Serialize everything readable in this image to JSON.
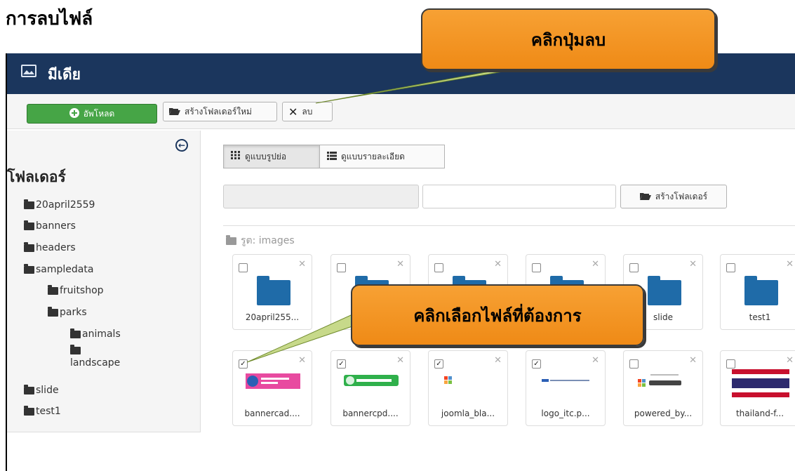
{
  "doc_title": "การลบไฟล์",
  "header": {
    "title": "มีเดีย"
  },
  "toolbar": {
    "upload_label": "อัพโหลด",
    "new_folder_label": "สร้างโฟลเดอร์ใหม่",
    "delete_label": "ลบ"
  },
  "sidebar": {
    "title": "โฟลเดอร์",
    "folders": [
      {
        "label": "20april2559"
      },
      {
        "label": "banners"
      },
      {
        "label": "headers"
      },
      {
        "label": "sampledata"
      },
      {
        "label": "fruitshop"
      },
      {
        "label": "parks"
      },
      {
        "label": "animals"
      },
      {
        "label": "landscape"
      },
      {
        "label": "slide"
      },
      {
        "label": "test1"
      }
    ]
  },
  "view": {
    "thumbnails_label": "ดูแบบรูปย่อ",
    "details_label": "ดูแบบรายละเอียด"
  },
  "folder_form": {
    "path_value": "",
    "folder_name_value": "",
    "create_label": "สร้างโฟลเดอร์"
  },
  "breadcrumb": {
    "root_label": "รูต: images"
  },
  "items": [
    {
      "name": "20april255...",
      "type": "folder",
      "checked": false
    },
    {
      "name": "",
      "type": "folder",
      "checked": false
    },
    {
      "name": "",
      "type": "folder",
      "checked": false
    },
    {
      "name": "",
      "type": "folder",
      "checked": false
    },
    {
      "name": "slide",
      "type": "folder",
      "checked": false
    },
    {
      "name": "test1",
      "type": "folder",
      "checked": false
    },
    {
      "name": "bannercad....",
      "type": "image",
      "checked": true
    },
    {
      "name": "bannercpd....",
      "type": "image",
      "checked": true
    },
    {
      "name": "joomla_bla...",
      "type": "image",
      "checked": true
    },
    {
      "name": "logo_itc.p...",
      "type": "image",
      "checked": true
    },
    {
      "name": "powered_by...",
      "type": "image",
      "checked": false
    },
    {
      "name": "thailand-f...",
      "type": "image",
      "checked": false
    }
  ],
  "callouts": {
    "delete": "คลิกปุ่มลบ",
    "select": "คลิกเลือกไฟล์ที่ต้องการ"
  },
  "colors": {
    "header_bg": "#1b365d",
    "upload_btn": "#46a546",
    "folder_icon": "#1f6ba8",
    "callout": "#f39325"
  },
  "icons": {
    "header": "image-icon",
    "upload": "plus-circle-icon",
    "new_folder": "folder-open-icon",
    "delete": "close-icon",
    "collapse": "arrow-left-circle-icon",
    "thumbnails": "grid-icon",
    "details": "list-icon"
  }
}
